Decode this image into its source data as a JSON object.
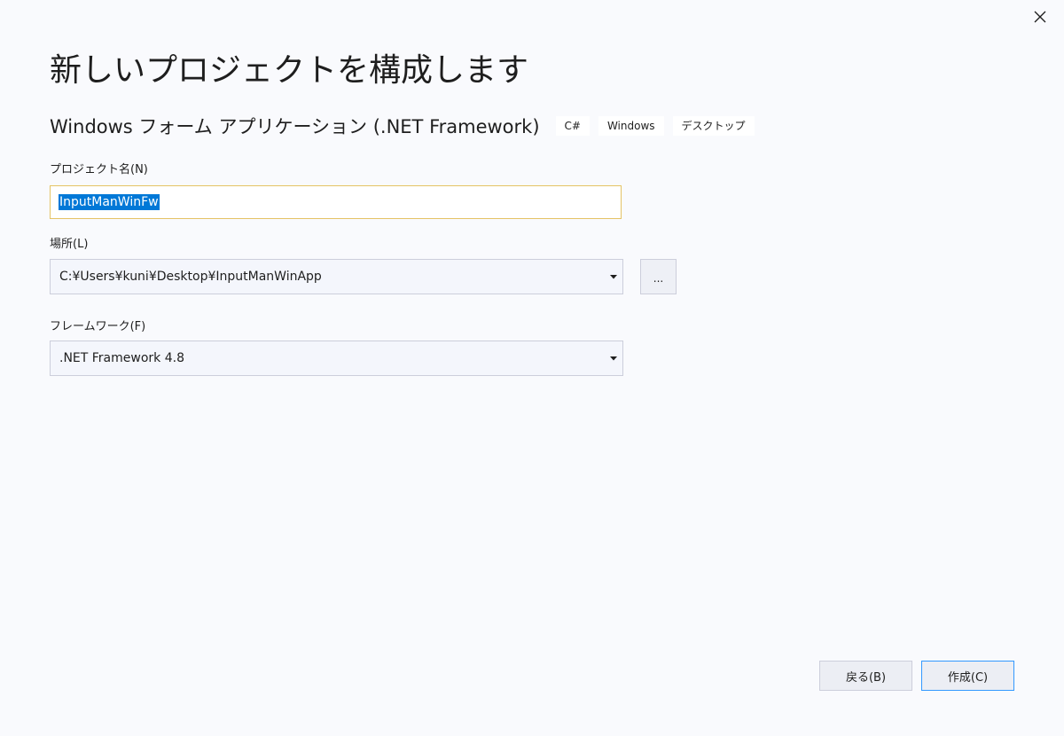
{
  "page": {
    "title": "新しいプロジェクトを構成します"
  },
  "template": {
    "name": "Windows フォーム アプリケーション (.NET Framework)",
    "tags": [
      "C#",
      "Windows",
      "デスクトップ"
    ]
  },
  "fields": {
    "project_name": {
      "label": "プロジェクト名(N)",
      "value": "InputManWinFw"
    },
    "location": {
      "label": "場所(L)",
      "value": "C:¥Users¥kuni¥Desktop¥InputManWinApp",
      "browse_label": "..."
    },
    "framework": {
      "label": "フレームワーク(F)",
      "value": ".NET Framework 4.8"
    }
  },
  "footer": {
    "back_label": "戻る(B)",
    "create_label": "作成(C)"
  },
  "icons": {
    "close": "close-icon",
    "dropdown": "chevron-down-icon"
  },
  "colors": {
    "background": "#f9fafd",
    "focus_border": "#e5c365",
    "selection": "#0078d7",
    "default_button_border": "#3399ff"
  }
}
